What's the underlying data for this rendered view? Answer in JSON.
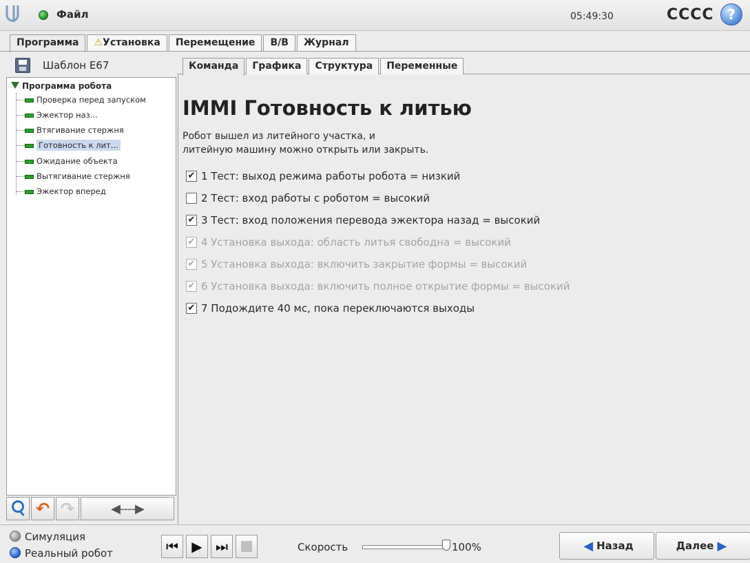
{
  "header": {
    "menu_file": "Файл",
    "clock": "05:49:30",
    "robot_name": "CCCC",
    "help": "?"
  },
  "main_tabs": [
    {
      "label": "Программа",
      "active": true
    },
    {
      "label": "Установка",
      "warning": true
    },
    {
      "label": "Перемещение"
    },
    {
      "label": "В/В"
    },
    {
      "label": "Журнал"
    }
  ],
  "program": {
    "name": "Шаблон E67",
    "root": "Программа робота",
    "nodes": [
      "Проверка перед запуском",
      "Эжектор наз...",
      "Втягивание стержня",
      "Готовность к лит...",
      "Ожидание объекта",
      "Вытягивание стержня",
      "Эжектор вперед"
    ],
    "selected_index": 3
  },
  "sub_tabs": [
    {
      "label": "Команда",
      "active": true
    },
    {
      "label": "Графика"
    },
    {
      "label": "Структура"
    },
    {
      "label": "Переменные"
    }
  ],
  "command": {
    "title": "IMMI Готовность к литью",
    "desc_line1": "Робот вышел из литейного участка, и",
    "desc_line2": "литейную машину можно открыть или закрыть.",
    "checks": [
      {
        "label": "1 Тест: выход режима работы робота = низкий",
        "checked": true,
        "enabled": true
      },
      {
        "label": "2 Тест: вход работы с роботом = высокий",
        "checked": false,
        "enabled": true
      },
      {
        "label": "3 Тест: вход положения перевода эжектора назад = высокий",
        "checked": true,
        "enabled": true
      },
      {
        "label": "4 Установка выхода: область литья свободна = высокий",
        "checked": true,
        "enabled": false
      },
      {
        "label": "5 Установка выхода: включить закрытие формы = высокий",
        "checked": true,
        "enabled": false
      },
      {
        "label": "6 Установка выхода: включить полное открытие формы = высокий",
        "checked": true,
        "enabled": false
      },
      {
        "label": "7 Подождите 40 мс, пока переключаются выходы",
        "checked": true,
        "enabled": true
      }
    ]
  },
  "footer": {
    "mode_sim": "Симуляция",
    "mode_real": "Реальный робот",
    "speed_label": "Скорость",
    "speed_value": "100%",
    "back": "Назад",
    "next": "Далее"
  },
  "icons": {
    "logo": "ur-logo-icon",
    "status": "status-dot-icon",
    "help": "help-icon",
    "warning": "warning-icon",
    "save": "save-icon",
    "search": "search-icon",
    "undo": "undo-icon",
    "redo": "redo-icon",
    "move": "move-arrows-icon"
  },
  "colors": {
    "accent_blue": "#2b62c2",
    "command_green": "#2aa02a",
    "selection": "#cad9ee",
    "warning": "#d9a100"
  }
}
